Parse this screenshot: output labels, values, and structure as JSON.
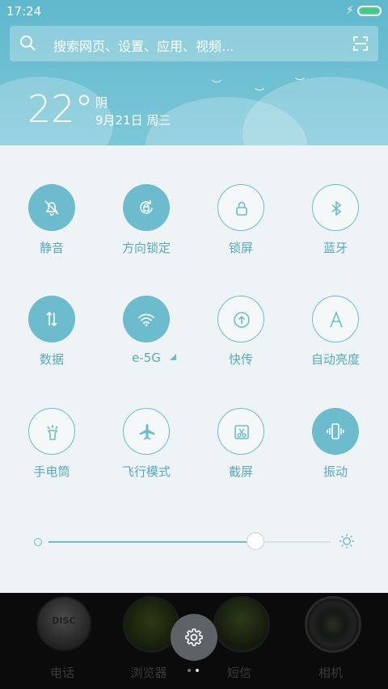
{
  "status_bar": {
    "time": "17:24"
  },
  "search": {
    "placeholder": "搜索网页、设置、应用、视频..."
  },
  "weather": {
    "temperature": "22°",
    "condition": "阴",
    "date": "9月21日 周三"
  },
  "toggles": [
    {
      "label": "静音",
      "icon": "bell-off-icon",
      "on": true
    },
    {
      "label": "方向锁定",
      "icon": "rotation-lock-icon",
      "on": true
    },
    {
      "label": "锁屏",
      "icon": "lock-icon",
      "on": false
    },
    {
      "label": "蓝牙",
      "icon": "bluetooth-icon",
      "on": false
    },
    {
      "label": "数据",
      "icon": "data-arrows-icon",
      "on": true
    },
    {
      "label": "e-5G",
      "icon": "wifi-icon",
      "on": true
    },
    {
      "label": "快传",
      "icon": "upload-icon",
      "on": false
    },
    {
      "label": "自动亮度",
      "icon": "auto-brightness-icon",
      "on": false
    },
    {
      "label": "手电筒",
      "icon": "flashlight-icon",
      "on": false
    },
    {
      "label": "飞行模式",
      "icon": "airplane-icon",
      "on": false
    },
    {
      "label": "截屏",
      "icon": "screenshot-icon",
      "on": false
    },
    {
      "label": "振动",
      "icon": "vibrate-icon",
      "on": true
    }
  ],
  "brightness": {
    "level": 0.73
  },
  "dock": {
    "apps": [
      {
        "label": "电话",
        "icon": "phone-disc-icon"
      },
      {
        "label": "浏览器",
        "icon": "browser-globe-icon"
      },
      {
        "label": "短信",
        "icon": "messages-icon"
      },
      {
        "label": "相机",
        "icon": "camera-icon"
      }
    ]
  },
  "colors": {
    "accent": "#6cbccd",
    "header": "#6cbccd",
    "panel": "#eef3f5"
  }
}
